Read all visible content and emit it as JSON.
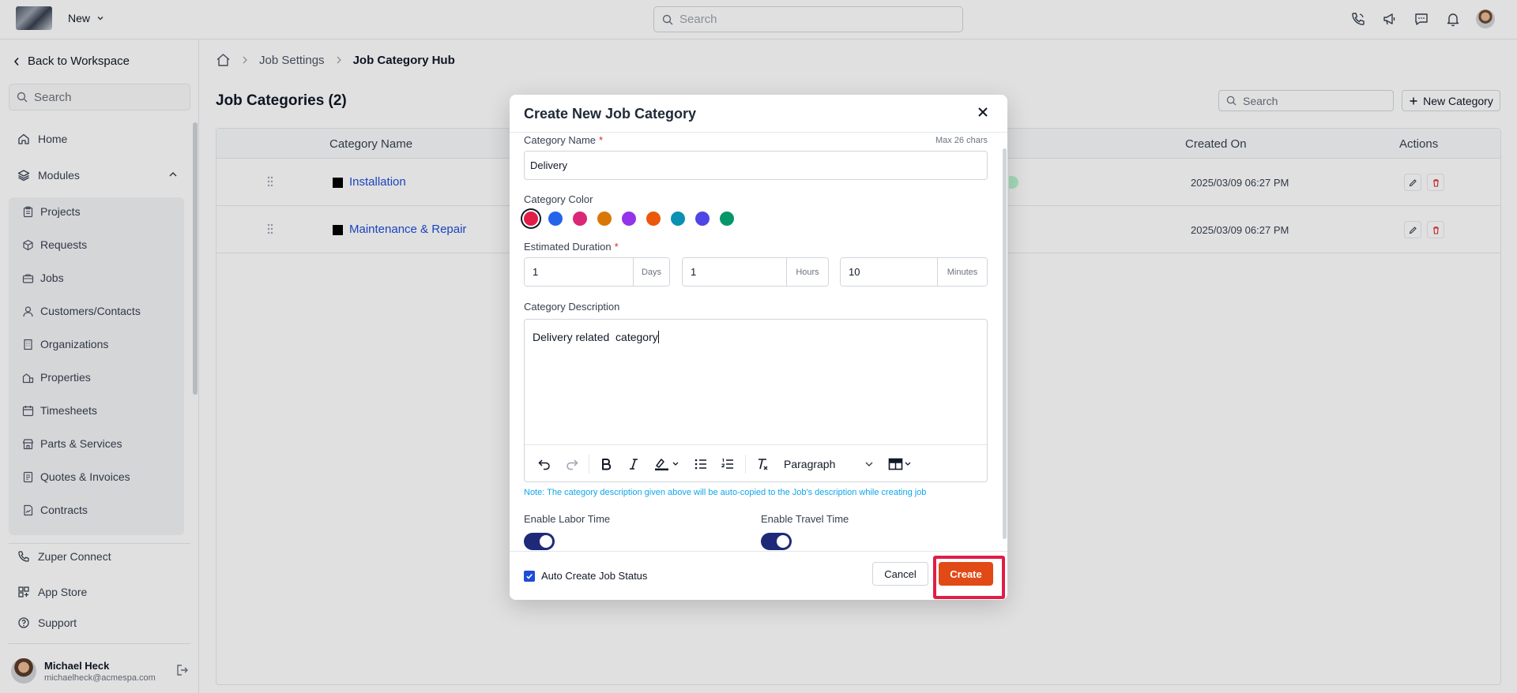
{
  "topbar": {
    "new_label": "New",
    "search_placeholder": "Search"
  },
  "sidebar": {
    "back_label": "Back to Workspace",
    "search_placeholder": "Search",
    "home": "Home",
    "modules": "Modules",
    "module_items": [
      "Projects",
      "Requests",
      "Jobs",
      "Customers/Contacts",
      "Organizations",
      "Properties",
      "Timesheets",
      "Parts & Services",
      "Quotes & Invoices",
      "Contracts"
    ],
    "zuper_connect": "Zuper Connect",
    "app_store": "App Store",
    "support": "Support",
    "user_name": "Michael Heck",
    "user_email": "michaelheck@acmespa.com"
  },
  "breadcrumb": {
    "items": [
      "Job Settings",
      "Job Category Hub"
    ]
  },
  "page": {
    "title": "Job Categories (2)",
    "search_placeholder": "Search",
    "new_category_label": "New Category"
  },
  "table": {
    "columns": {
      "name": "Category Name",
      "created": "Created On",
      "actions": "Actions"
    },
    "rows": [
      {
        "name": "Installation",
        "created": "2025/03/09 06:27 PM"
      },
      {
        "name": "Maintenance & Repair",
        "created": "2025/03/09 06:27 PM"
      }
    ]
  },
  "modal": {
    "title": "Create New Job Category",
    "name_label": "Category Name",
    "required_mark": "*",
    "max_chars": "Max 26 chars",
    "name_value": "Delivery",
    "color_label": "Category Color",
    "colors": [
      "#e11d48",
      "#2563eb",
      "#db2777",
      "#d97706",
      "#9333ea",
      "#ea580c",
      "#0891b2",
      "#4f46e5",
      "#059669"
    ],
    "duration_label": "Estimated Duration",
    "duration": {
      "days_value": "1",
      "days_unit": "Days",
      "hours_value": "1",
      "hours_unit": "Hours",
      "minutes_value": "10",
      "minutes_unit": "Minutes"
    },
    "description_label": "Category Description",
    "description_value": "Delivery related  category",
    "paragraph_label": "Paragraph",
    "note": "Note: The category description given above will be auto-copied to the Job's description while creating job",
    "labor_label": "Enable Labor Time",
    "travel_label": "Enable Travel Time",
    "auto_status_label": "Auto Create Job Status",
    "cancel_label": "Cancel",
    "create_label": "Create"
  }
}
